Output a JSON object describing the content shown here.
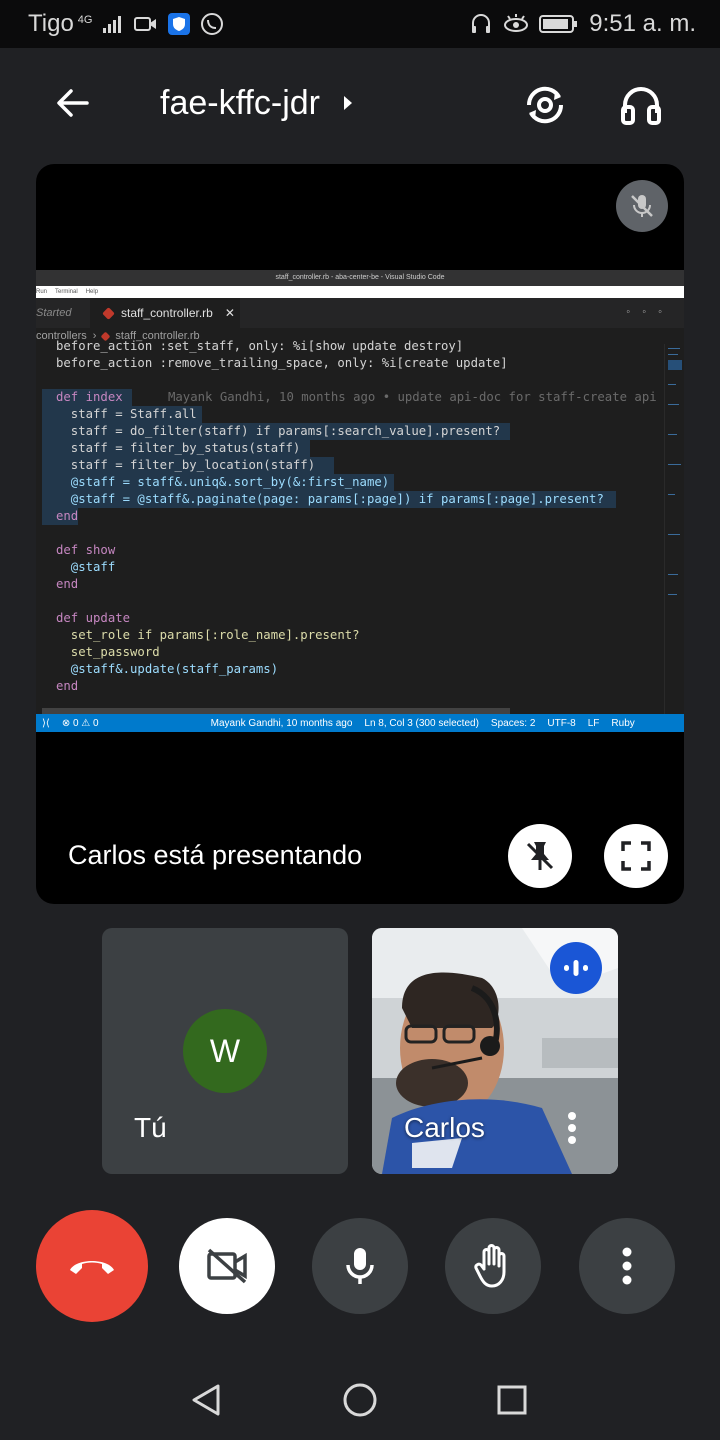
{
  "status_bar": {
    "carrier": "Tigo",
    "network": "4G",
    "time": "9:51 a. m."
  },
  "header": {
    "meeting_code": "fae-kffc-jdr"
  },
  "presentation": {
    "presenting_text": "Carlos está presentando",
    "editor": {
      "window_title": "staff_controller.rb - aba-center-be - Visual Studio Code",
      "menu_items": [
        "Run",
        "Terminal",
        "Help"
      ],
      "inactive_tab": "Started",
      "active_tab": "staff_controller.rb",
      "breadcrumb_folder": "controllers",
      "breadcrumb_file": "staff_controller.rb",
      "code_lines": [
        "before_action :set_staff, only: %i[show update destroy]",
        "before_action :remove_trailing_space, only: %i[create update]",
        "",
        "def index",
        "  staff = Staff.all",
        "  staff = do_filter(staff) if params[:search_value].present?",
        "  staff = filter_by_status(staff)",
        "  staff = filter_by_location(staff)",
        "  @staff = staff&.uniq&.sort_by(&:first_name)",
        "  @staff = @staff&.paginate(page: params[:page]) if params[:page].present?",
        "end",
        "",
        "def show",
        "  @staff",
        "end",
        "",
        "def update",
        "  set_role if params[:role_name].present?",
        "  set_password",
        "  @staff&.update(staff_params)",
        "end"
      ],
      "blame_annotation": "Mayank Gandhi, 10 months ago • update api-doc for staff-create api",
      "status_bar": {
        "problems": "⊗ 0 ⚠ 0",
        "blame": "Mayank Gandhi, 10 months ago",
        "cursor": "Ln 8, Col 3 (300 selected)",
        "spaces": "Spaces: 2",
        "encoding": "UTF-8",
        "eol": "LF",
        "language": "Ruby"
      }
    }
  },
  "participants": {
    "self": {
      "initial": "W",
      "name": "Tú",
      "avatar_color": "#33691e"
    },
    "other": {
      "name": "Carlos",
      "speaking_badge_color": "#1a56d6"
    }
  },
  "controls": {
    "end_call_color": "#ea4335",
    "icons": [
      "end-call-icon",
      "camera-off-icon",
      "mic-icon",
      "hand-icon",
      "more-vert-icon"
    ]
  }
}
